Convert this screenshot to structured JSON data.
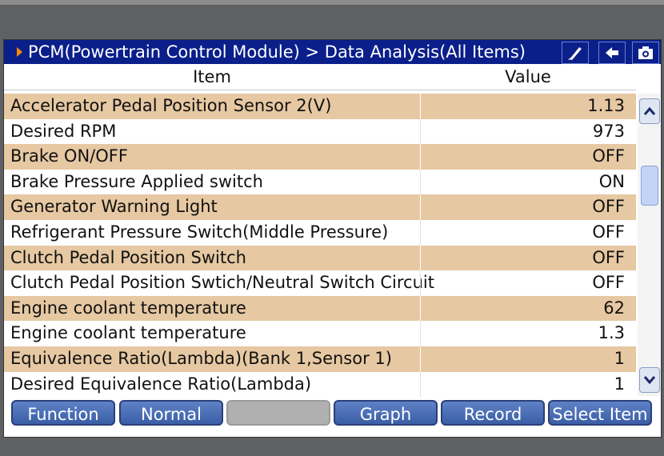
{
  "title": "PCM(Powertrain Control Module) > Data Analysis(All Items)",
  "columns": {
    "item": "Item",
    "value": "Value"
  },
  "rows": [
    {
      "name": "Accelerator Pedal Position Sensor 2(V)",
      "value": "1.13"
    },
    {
      "name": "Desired RPM",
      "value": "973"
    },
    {
      "name": "Brake ON/OFF",
      "value": "OFF"
    },
    {
      "name": "Brake Pressure Applied switch",
      "value": "ON"
    },
    {
      "name": "Generator Warning Light",
      "value": "OFF"
    },
    {
      "name": "Refrigerant Pressure Switch(Middle Pressure)",
      "value": "OFF"
    },
    {
      "name": "Clutch Pedal Position Switch",
      "value": "OFF"
    },
    {
      "name": "Clutch Pedal Position Swtich/Neutral Switch Circuit",
      "value": "OFF"
    },
    {
      "name": "Engine coolant temperature",
      "value": "62"
    },
    {
      "name": "Engine coolant temperature",
      "value": "1.3"
    },
    {
      "name": "Equivalence Ratio(Lambda)(Bank 1,Sensor 1)",
      "value": "1"
    },
    {
      "name": "Desired Equivalence Ratio(Lambda)",
      "value": "1"
    }
  ],
  "buttons": {
    "function": "Function",
    "normal": "Normal",
    "empty": "",
    "graph": "Graph",
    "record": "Record",
    "select_item": "Select Item"
  },
  "icons": {
    "brush": "paint-brush-icon",
    "back": "back-arrow-icon",
    "camera": "camera-icon"
  },
  "colors": {
    "titlebar": "#0a1f8a",
    "row_shade": "#e6c8a2",
    "button": "#4a6eb4",
    "accent_arrow": "#ff8c00"
  }
}
